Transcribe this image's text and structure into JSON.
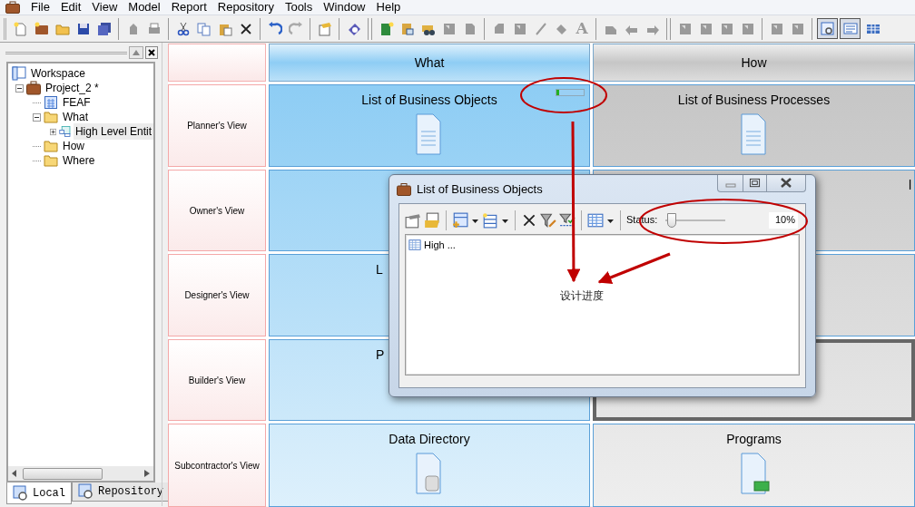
{
  "menu": [
    "File",
    "Edit",
    "View",
    "Model",
    "Report",
    "Repository",
    "Tools",
    "Window",
    "Help"
  ],
  "toolbar": {
    "text_button": "A",
    "views": [
      {
        "selected": true
      },
      {
        "selected": true
      },
      {
        "selected": false
      }
    ]
  },
  "explorer": {
    "tree": [
      {
        "label": "Workspace",
        "kind": "workspace",
        "selected": false,
        "children": [
          {
            "label": "Project_2 *",
            "kind": "project",
            "selected": false,
            "expanded": true,
            "children": [
              {
                "label": "FEAF",
                "kind": "diagram",
                "selected": false
              },
              {
                "label": "What",
                "kind": "folder",
                "selected": false,
                "expanded": true,
                "children": [
                  {
                    "label": "High Level Entit",
                    "kind": "entity",
                    "selected": true,
                    "expanded": false
                  }
                ]
              },
              {
                "label": "How",
                "kind": "folder",
                "selected": false
              },
              {
                "label": "Where",
                "kind": "folder",
                "selected": false
              }
            ]
          }
        ]
      }
    ],
    "tabs": [
      {
        "label": "Local",
        "selected": true
      },
      {
        "label": "Repository",
        "selected": false
      }
    ]
  },
  "matrix": {
    "columns": [
      {
        "label": "What",
        "color": "#8ecdf4"
      },
      {
        "label": "How",
        "color": "#c6c6c6"
      }
    ],
    "rows": [
      {
        "label": "Planner's View",
        "cells": [
          {
            "title": "List of Business Objects",
            "kind": "document",
            "level": 0.1,
            "selected": false
          },
          {
            "title": "List of Business Processes",
            "kind": "document",
            "selected": false
          }
        ]
      },
      {
        "label": "Owner's View",
        "cells": [
          {
            "selected": false
          },
          {
            "title": "l",
            "kind": "partial",
            "selected": false
          }
        ]
      },
      {
        "label": "Designer's View",
        "cells": [
          {
            "title": "L",
            "kind": "partial",
            "selected": false
          },
          {
            "selected": false
          }
        ]
      },
      {
        "label": "Builder's View",
        "cells": [
          {
            "title": "P",
            "kind": "partial",
            "selected": false
          },
          {
            "selected": true
          }
        ]
      },
      {
        "label": "Subcontractor's View",
        "cells": [
          {
            "title": "Data Directory",
            "kind": "data",
            "selected": false
          },
          {
            "title": "Programs",
            "kind": "program",
            "selected": false
          }
        ]
      }
    ]
  },
  "dialog": {
    "title": "List of Business Objects",
    "status": {
      "label": "Status:",
      "level": 0.1,
      "reading": "10%"
    },
    "items": [
      {
        "label": "High ..."
      }
    ],
    "note": "设计进度"
  }
}
